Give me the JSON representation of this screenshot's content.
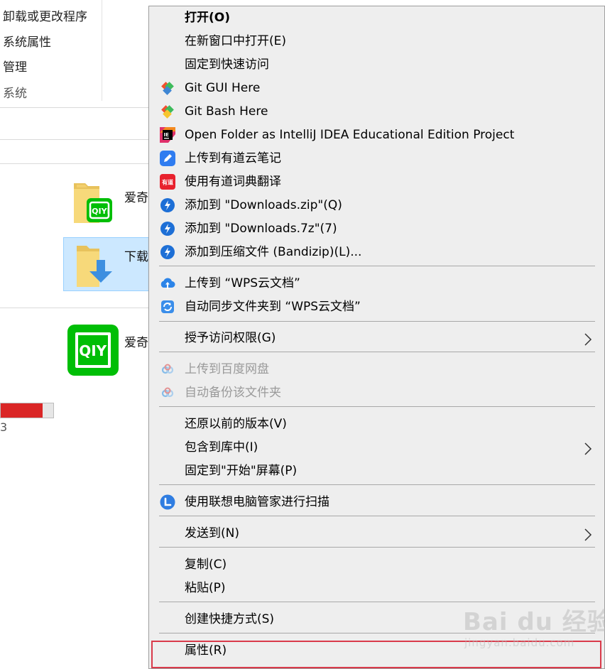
{
  "explorer": {
    "ribbon": [
      "卸载或更改程序",
      "系统属性",
      "管理"
    ],
    "ribbon_group": "系统",
    "items": [
      {
        "label": "爱奇"
      },
      {
        "label": "下载"
      },
      {
        "label": "爱奇"
      }
    ],
    "disk_usage_percent": 80,
    "peek_char": "3"
  },
  "context_menu": {
    "items": [
      {
        "label": "打开(O)",
        "icon": null,
        "bold": true
      },
      {
        "label": "在新窗口中打开(E)",
        "icon": null
      },
      {
        "label": "固定到快速访问",
        "icon": null
      },
      {
        "label": "Git GUI Here",
        "icon": "git-gui-icon"
      },
      {
        "label": "Git Bash Here",
        "icon": "git-bash-icon"
      },
      {
        "label": "Open Folder as IntelliJ IDEA Educational Edition Project",
        "icon": "intellij-icon"
      },
      {
        "label": "上传到有道云笔记",
        "icon": "youdao-note-icon"
      },
      {
        "label": "使用有道词典翻译",
        "icon": "youdao-dict-icon",
        "icon_text": "有道"
      },
      {
        "label": "添加到 \"Downloads.zip\"(Q)",
        "icon": "bandizip-icon"
      },
      {
        "label": "添加到 \"Downloads.7z\"(7)",
        "icon": "bandizip-icon"
      },
      {
        "label": "添加到压缩文件 (Bandizip)(L)...",
        "icon": "bandizip-icon"
      },
      {
        "label": "上传到 “WPS云文档”",
        "icon": "wps-upload-icon"
      },
      {
        "label": "自动同步文件夹到 “WPS云文档”",
        "icon": "wps-sync-icon"
      },
      {
        "label": "授予访问权限(G)",
        "icon": null,
        "submenu": true
      },
      {
        "label": "上传到百度网盘",
        "icon": "baidu-netdisk-icon",
        "disabled": true
      },
      {
        "label": "自动备份该文件夹",
        "icon": "baidu-netdisk-icon",
        "disabled": true
      },
      {
        "label": "还原以前的版本(V)",
        "icon": null
      },
      {
        "label": "包含到库中(I)",
        "icon": null,
        "submenu": true
      },
      {
        "label": "固定到\"开始\"屏幕(P)",
        "icon": null
      },
      {
        "label": "使用联想电脑管家进行扫描",
        "icon": "lenovo-icon"
      },
      {
        "label": "发送到(N)",
        "icon": null,
        "submenu": true
      },
      {
        "label": "复制(C)",
        "icon": null
      },
      {
        "label": "粘贴(P)",
        "icon": null
      },
      {
        "label": "创建快捷方式(S)",
        "icon": null
      },
      {
        "label": "属性(R)",
        "icon": null,
        "highlighted": true
      }
    ]
  },
  "watermark": {
    "logo": "Bai du 经验",
    "url": "jingyan.baidu.com"
  },
  "colors": {
    "menu_bg": "#eeeeee",
    "selection": "#cce8ff",
    "iqiyi_green": "#00be06",
    "highlight_border": "#d93a4a",
    "disk_bar": "#da2626"
  }
}
